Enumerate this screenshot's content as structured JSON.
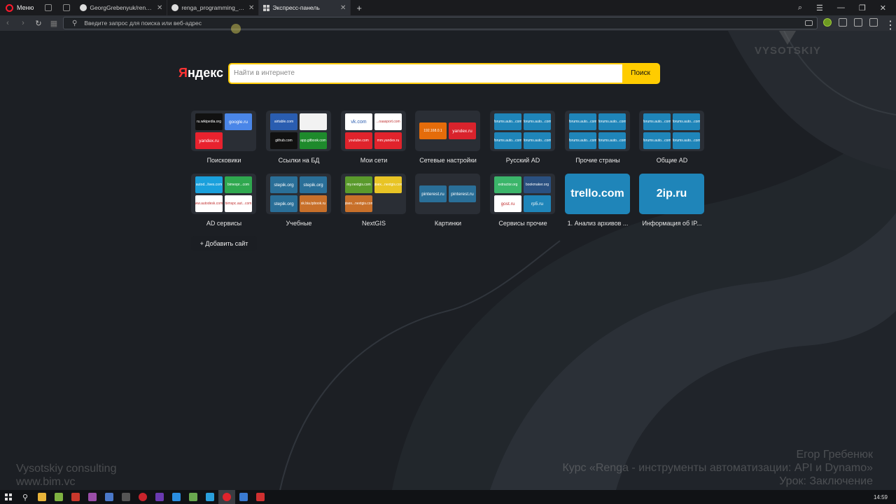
{
  "browser": {
    "menu_label": "Меню",
    "tabs": [
      {
        "label": "GeorgGrebenyuk/renga_pr",
        "icon": "github-icon"
      },
      {
        "label": "renga_programming_cours",
        "icon": "github-icon"
      },
      {
        "label": "Экспресс-панель",
        "icon": "grid-icon",
        "active": true
      }
    ],
    "address_placeholder": "Введите запрос для поиска или веб-адрес"
  },
  "yandex": {
    "logo_first": "Я",
    "logo_rest": "ндекс",
    "search_placeholder": "Найти в интернете",
    "search_button": "Поиск"
  },
  "speed_dial": [
    {
      "caption": "Поисковики",
      "minis": [
        {
          "text": "ru.wikipedia.org",
          "color": "#111111"
        },
        {
          "text": "google.ru",
          "color": "#4a86e8"
        },
        {
          "text": "yandex.ru",
          "color": "#e8222e"
        }
      ]
    },
    {
      "caption": "Ссылки на БД",
      "minis": [
        {
          "text": "airtable.com",
          "color": "#2a5db0"
        },
        {
          "text": "",
          "color": "#f2f2f2"
        },
        {
          "text": "github.com",
          "color": "#111111"
        },
        {
          "text": "app.gitbook.com",
          "color": "#1e8a2c"
        }
      ]
    },
    {
      "caption": "Мои сети",
      "minis": [
        {
          "text": "vk.com",
          "color": "#ffffff"
        },
        {
          "text": "...oaasport.com",
          "color": "#ffffff"
        },
        {
          "text": "youtube.com",
          "color": "#e0232c"
        },
        {
          "text": "mm.yandex.ru",
          "color": "#e0232c"
        }
      ]
    },
    {
      "caption": "Сетевые настройки",
      "minis": [
        {
          "text": "192.168.0.1",
          "color": "#e56c0a"
        },
        {
          "text": "yandex.ru",
          "color": "#d9232c"
        }
      ]
    },
    {
      "caption": "Русский AD",
      "minis": [
        {
          "text": "forums.auto...com",
          "color": "#1f85b9"
        },
        {
          "text": "forums.auto...com",
          "color": "#1f85b9"
        },
        {
          "text": "forums.auto...com",
          "color": "#1f85b9"
        },
        {
          "text": "forums.auto...com",
          "color": "#1f85b9"
        }
      ]
    },
    {
      "caption": "Прочие страны",
      "minis": [
        {
          "text": "forums.auto...com",
          "color": "#1f85b9"
        },
        {
          "text": "forums.auto...com",
          "color": "#1f85b9"
        },
        {
          "text": "forums.auto...com",
          "color": "#1f85b9"
        },
        {
          "text": "forums.auto...com",
          "color": "#1f85b9"
        }
      ]
    },
    {
      "caption": "Общие AD",
      "minis": [
        {
          "text": "forums.auto...com",
          "color": "#1f85b9"
        },
        {
          "text": "forums.auto...com",
          "color": "#1f85b9"
        },
        {
          "text": "forums.auto...com",
          "color": "#1f85b9"
        },
        {
          "text": "forums.auto...com",
          "color": "#1f85b9"
        }
      ]
    },
    {
      "caption": "AD сервисы",
      "minis": [
        {
          "text": "autod...lives.com",
          "color": "#1aa0dc"
        },
        {
          "text": "bimexpr...com",
          "color": "#2fa84f"
        },
        {
          "text": "ww.autodesk.com",
          "color": "#ffffff"
        },
        {
          "text": "bimspc.aut...com",
          "color": "#ffffff"
        }
      ]
    },
    {
      "caption": "Учебные",
      "minis": [
        {
          "text": "stepik.org",
          "color": "#2a6f98"
        },
        {
          "text": "stepik.org",
          "color": "#2a6f98"
        },
        {
          "text": "stepik.org",
          "color": "#2a6f98"
        },
        {
          "text": "sk.bia.tpbook.ru",
          "color": "#c8702a"
        }
      ]
    },
    {
      "caption": "NextGIS",
      "minis": [
        {
          "text": "my.nextgis.com",
          "color": "#5a9a2c"
        },
        {
          "text": "gisex...nextgis.com",
          "color": "#e8c425"
        },
        {
          "text": "gisex...nextgis.com",
          "color": "#c8702a"
        }
      ]
    },
    {
      "caption": "Картинки",
      "minis": [
        {
          "text": "pinterest.ru",
          "color": "#2a6f98"
        },
        {
          "text": "pinterest.ru",
          "color": "#2a6f98"
        }
      ]
    },
    {
      "caption": "Сервисы прочие",
      "minis": [
        {
          "text": "extractor.org",
          "color": "#3bb56a"
        },
        {
          "text": "bookmaker.org",
          "color": "#2a5080"
        },
        {
          "text": "gost.ru",
          "color": "#ffffff"
        },
        {
          "text": "rp5.ru",
          "color": "#1f85b9"
        }
      ]
    },
    {
      "caption": "1. Анализ архивов ...",
      "single": "trello.com"
    },
    {
      "caption": "Информация об IP...",
      "single": "2ip.ru"
    }
  ],
  "add_site_label": "+ Добавить сайт",
  "watermarks": {
    "logo_text": "VYSOTSKIY",
    "left_line1": "Vysotskiy consulting",
    "left_line2": "www.bim.vc",
    "right_line1": "Егор Гребенюк",
    "right_line2": "Курс «Renga - инструменты автоматизации: API и Dynamo»",
    "right_line3": "Урок: Заключение"
  },
  "taskbar": {
    "clock": "14:59",
    "apps": [
      {
        "name": "explorer",
        "color": "#e8b43a"
      },
      {
        "name": "app-green",
        "color": "#7fb241"
      },
      {
        "name": "app-red",
        "color": "#c8382c"
      },
      {
        "name": "app-purple",
        "color": "#9a4ea8"
      },
      {
        "name": "app-blue",
        "color": "#4a78c8"
      },
      {
        "name": "app-dark",
        "color": "#555555"
      },
      {
        "name": "app-rec",
        "color": "#c8242c"
      },
      {
        "name": "app-violet",
        "color": "#6a3ab0"
      },
      {
        "name": "vscode",
        "color": "#2a8ee0"
      },
      {
        "name": "app-screen",
        "color": "#6aa84f"
      },
      {
        "name": "telegram",
        "color": "#2aa0dc"
      },
      {
        "name": "opera",
        "color": "#e0232c",
        "active": true
      },
      {
        "name": "notes",
        "color": "#3a7ad0"
      },
      {
        "name": "app-red2",
        "color": "#d03030"
      }
    ]
  }
}
